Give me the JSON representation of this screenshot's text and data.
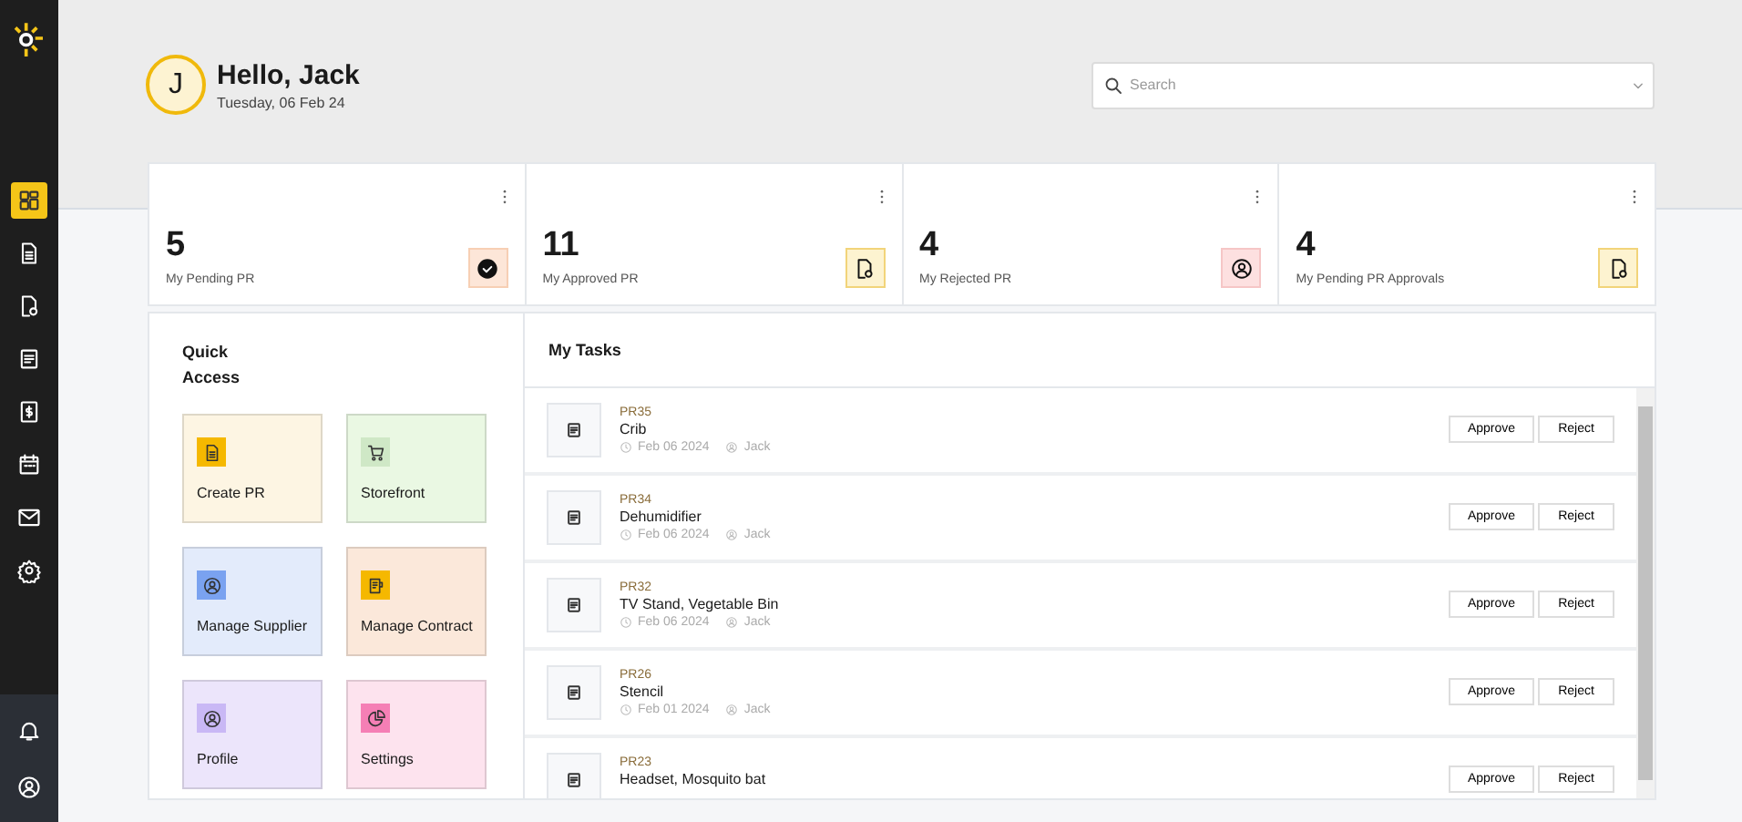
{
  "sidebar": {
    "items": [
      {
        "kind": "dashboard",
        "selected": true
      },
      {
        "kind": "document",
        "selected": false
      },
      {
        "kind": "document-badge",
        "selected": false
      },
      {
        "kind": "list",
        "selected": false
      },
      {
        "kind": "invoice",
        "selected": false
      },
      {
        "kind": "calendar",
        "selected": false
      },
      {
        "kind": "mail",
        "selected": false
      },
      {
        "kind": "gear",
        "selected": false
      }
    ],
    "bottom_items": [
      {
        "kind": "bell"
      },
      {
        "kind": "user"
      }
    ]
  },
  "header": {
    "avatar": "J",
    "greeting": "Hello, Jack",
    "date": "Tuesday, 06 Feb 24"
  },
  "search": {
    "placeholder": "Search"
  },
  "stats": [
    {
      "value": "5",
      "label": "My Pending PR",
      "kind": "check"
    },
    {
      "value": "11",
      "label": "My Approved PR",
      "kind": "document-badge"
    },
    {
      "value": "4",
      "label": "My Rejected PR",
      "kind": "user"
    },
    {
      "value": "4",
      "label": "My Pending PR Approvals",
      "kind": "document-badge"
    }
  ],
  "quick_access": {
    "title": "Quick Access",
    "tiles": [
      {
        "label": "Create PR",
        "kind": "document",
        "color": "#fdf5e3"
      },
      {
        "label": "Storefront",
        "kind": "cart",
        "color": "#eaf8e3"
      },
      {
        "label": "Manage Supplier",
        "kind": "user",
        "color": "#e3ebfb"
      },
      {
        "label": "Manage Contract",
        "kind": "contract",
        "color": "#fbe8da"
      },
      {
        "label": "Profile",
        "kind": "user",
        "color": "#ece5fb"
      },
      {
        "label": "Settings",
        "kind": "pie",
        "color": "#fde3ee"
      }
    ]
  },
  "tasks": {
    "title": "My Tasks",
    "rows": [
      {
        "id": "PR35",
        "name": "Crib",
        "date": "Feb 06 2024",
        "user": "Jack",
        "buttons": [
          "Approve",
          "Reject"
        ]
      },
      {
        "id": "PR34",
        "name": "Dehumidifier",
        "date": "Feb 06 2024",
        "user": "Jack",
        "buttons": [
          "Approve",
          "Reject"
        ]
      },
      {
        "id": "PR32",
        "name": "TV Stand, Vegetable Bin",
        "date": "Feb 06 2024",
        "user": "Jack",
        "buttons": [
          "Approve",
          "Reject"
        ]
      },
      {
        "id": "PR26",
        "name": "Stencil",
        "date": "Feb 01 2024",
        "user": "Jack",
        "buttons": [
          "Approve",
          "Reject"
        ]
      },
      {
        "id": "PR23",
        "name": "Headset, Mosquito bat",
        "buttons": [
          "Approve",
          "Reject"
        ]
      }
    ]
  }
}
